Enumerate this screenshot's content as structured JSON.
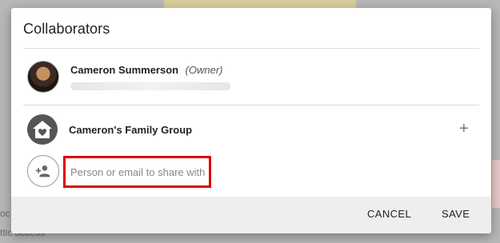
{
  "dialog": {
    "title": "Collaborators",
    "owner": {
      "name": "Cameron Summerson",
      "role": "(Owner)"
    },
    "group": {
      "name": "Cameron's Family Group"
    },
    "share": {
      "placeholder": "Person or email to share with"
    },
    "actions": {
      "cancel_label": "CANCEL",
      "save_label": "SAVE"
    },
    "highlight_color": "#e00000"
  },
  "background": {
    "text_line_1": "ttic access",
    "text_line_2": "oc"
  }
}
